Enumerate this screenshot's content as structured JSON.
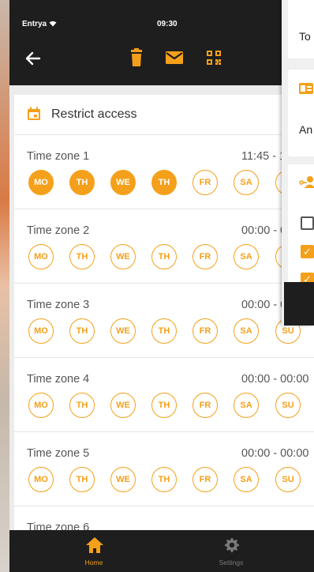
{
  "status": {
    "carrier": "Entrya",
    "time": "09:30"
  },
  "colors": {
    "accent": "#f5a01a",
    "dark": "#1e1e1e"
  },
  "toolbar": {
    "icons": [
      "back-arrow-icon",
      "trash-icon",
      "mail-icon",
      "qr-code-icon"
    ]
  },
  "card": {
    "title": "Restrict access"
  },
  "zones": [
    {
      "name": "Time zone 1",
      "time": "11:45 - 1",
      "days": [
        "MO",
        "TH",
        "WE",
        "TH",
        "FR",
        "SA",
        "SU"
      ],
      "active": [
        true,
        true,
        true,
        true,
        false,
        false,
        false
      ]
    },
    {
      "name": "Time zone 2",
      "time": "00:00 - 0",
      "days": [
        "MO",
        "TH",
        "WE",
        "TH",
        "FR",
        "SA",
        "SU"
      ],
      "active": [
        false,
        false,
        false,
        false,
        false,
        false,
        false
      ]
    },
    {
      "name": "Time zone 3",
      "time": "00:00 - 0",
      "days": [
        "MO",
        "TH",
        "WE",
        "TH",
        "FR",
        "SA",
        "SU"
      ],
      "active": [
        false,
        false,
        false,
        false,
        false,
        false,
        false
      ]
    },
    {
      "name": "Time zone 4",
      "time": "00:00 - 00:00",
      "days": [
        "MO",
        "TH",
        "WE",
        "TH",
        "FR",
        "SA",
        "SU"
      ],
      "active": [
        false,
        false,
        false,
        false,
        false,
        false,
        false
      ]
    },
    {
      "name": "Time zone 5",
      "time": "00:00 - 00:00",
      "days": [
        "MO",
        "TH",
        "WE",
        "TH",
        "FR",
        "SA",
        "SU"
      ],
      "active": [
        false,
        false,
        false,
        false,
        false,
        false,
        false
      ]
    },
    {
      "name": "Time zone 6",
      "time": "",
      "days": [],
      "active": []
    }
  ],
  "side_panel": {
    "text_top": "To",
    "text_mid": "An",
    "checkboxes": [
      false,
      true,
      true
    ]
  },
  "nav": {
    "home_label": "Home",
    "settings_label": "Settings"
  }
}
